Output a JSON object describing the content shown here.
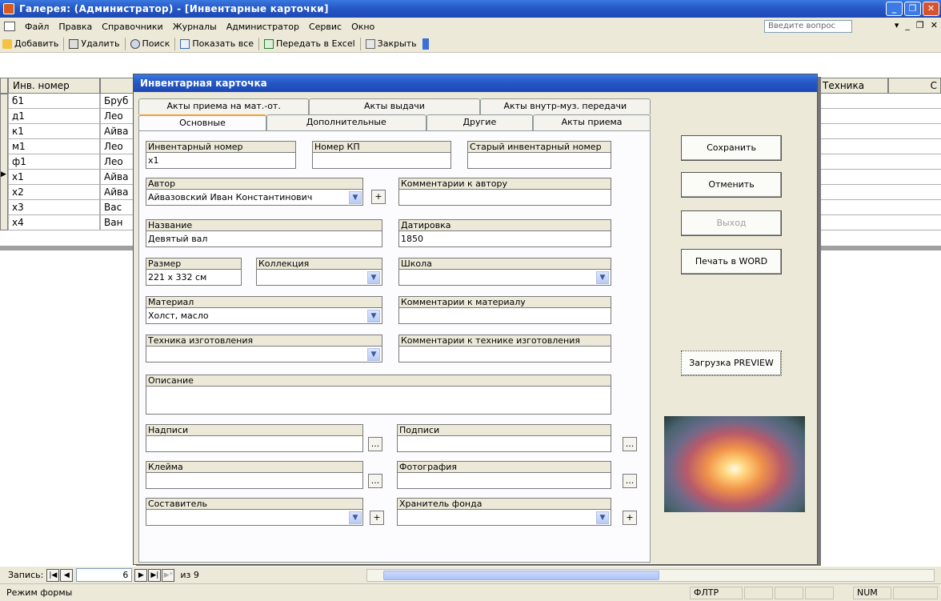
{
  "window": {
    "title": "Галерея: (Администратор) - [Инвентарные карточки]"
  },
  "menu": {
    "items": [
      "Файл",
      "Правка",
      "Справочники",
      "Журналы",
      "Администратор",
      "Сервис",
      "Окно"
    ],
    "ask_placeholder": "Введите вопрос"
  },
  "toolbar": {
    "add": "Добавить",
    "delete": "Удалить",
    "search": "Поиск",
    "show_all": "Показать все",
    "excel": "Передать в Excel",
    "close": "Закрыть"
  },
  "sheet": {
    "col_inv": "Инв. номер",
    "col_tech": "Техника",
    "col_last": "С",
    "rows": [
      {
        "inv": "б1",
        "name": "Бруб"
      },
      {
        "inv": "д1",
        "name": "Лео"
      },
      {
        "inv": "к1",
        "name": "Айва"
      },
      {
        "inv": "м1",
        "name": "Лео"
      },
      {
        "inv": "ф1",
        "name": "Лео"
      },
      {
        "inv": "x1",
        "name": "Айва"
      },
      {
        "inv": "x2",
        "name": "Айва"
      },
      {
        "inv": "x3",
        "name": "Вас"
      },
      {
        "inv": "x4",
        "name": "Ван"
      }
    ]
  },
  "dialog": {
    "title": "Инвентарная карточка",
    "tabs_top": [
      "Акты приема на мат.-от.",
      "Акты выдачи",
      "Акты внутр-муз. передачи"
    ],
    "tabs_bottom": [
      "Основные",
      "Дополнительные",
      "Другие",
      "Акты приема"
    ],
    "fields": {
      "inv_number_label": "Инвентарный номер",
      "inv_number_value": "x1",
      "kp_label": "Номер КП",
      "old_inv_label": "Старый инвентарный номер",
      "author_label": "Автор",
      "author_value": "Айвазовский Иван Константинович",
      "author_comment_label": "Комментарии к автору",
      "title_label": "Название",
      "title_value": "Девятый вал",
      "dating_label": "Датировка",
      "dating_value": "1850",
      "size_label": "Размер",
      "size_value": "221 x 332 см",
      "collection_label": "Коллекция",
      "school_label": "Школа",
      "material_label": "Материал",
      "material_value": "Холст, масло",
      "material_comment_label": "Комментарии к материалу",
      "technique_label": "Техника изготовления",
      "technique_comment_label": "Комментарии к технике изготовления",
      "description_label": "Описание",
      "inscriptions_label": "Надписи",
      "signatures_label": "Подписи",
      "stamps_label": "Клейма",
      "photo_label": "Фотография",
      "compiler_label": "Составитель",
      "keeper_label": "Хранитель фонда"
    },
    "buttons": {
      "save": "Сохранить",
      "cancel": "Отменить",
      "exit": "Выход",
      "print": "Печать в WORD",
      "load_preview": "Загрузка PREVIEW"
    }
  },
  "nav": {
    "label": "Запись:",
    "current": "6",
    "of_text": "из 9"
  },
  "status": {
    "mode": "Режим формы",
    "filter": "ФЛТР",
    "num": "NUM"
  },
  "colors": {
    "titlebar": "#2456c4",
    "face": "#ece9d8",
    "tab_accent": "#f0a030"
  }
}
